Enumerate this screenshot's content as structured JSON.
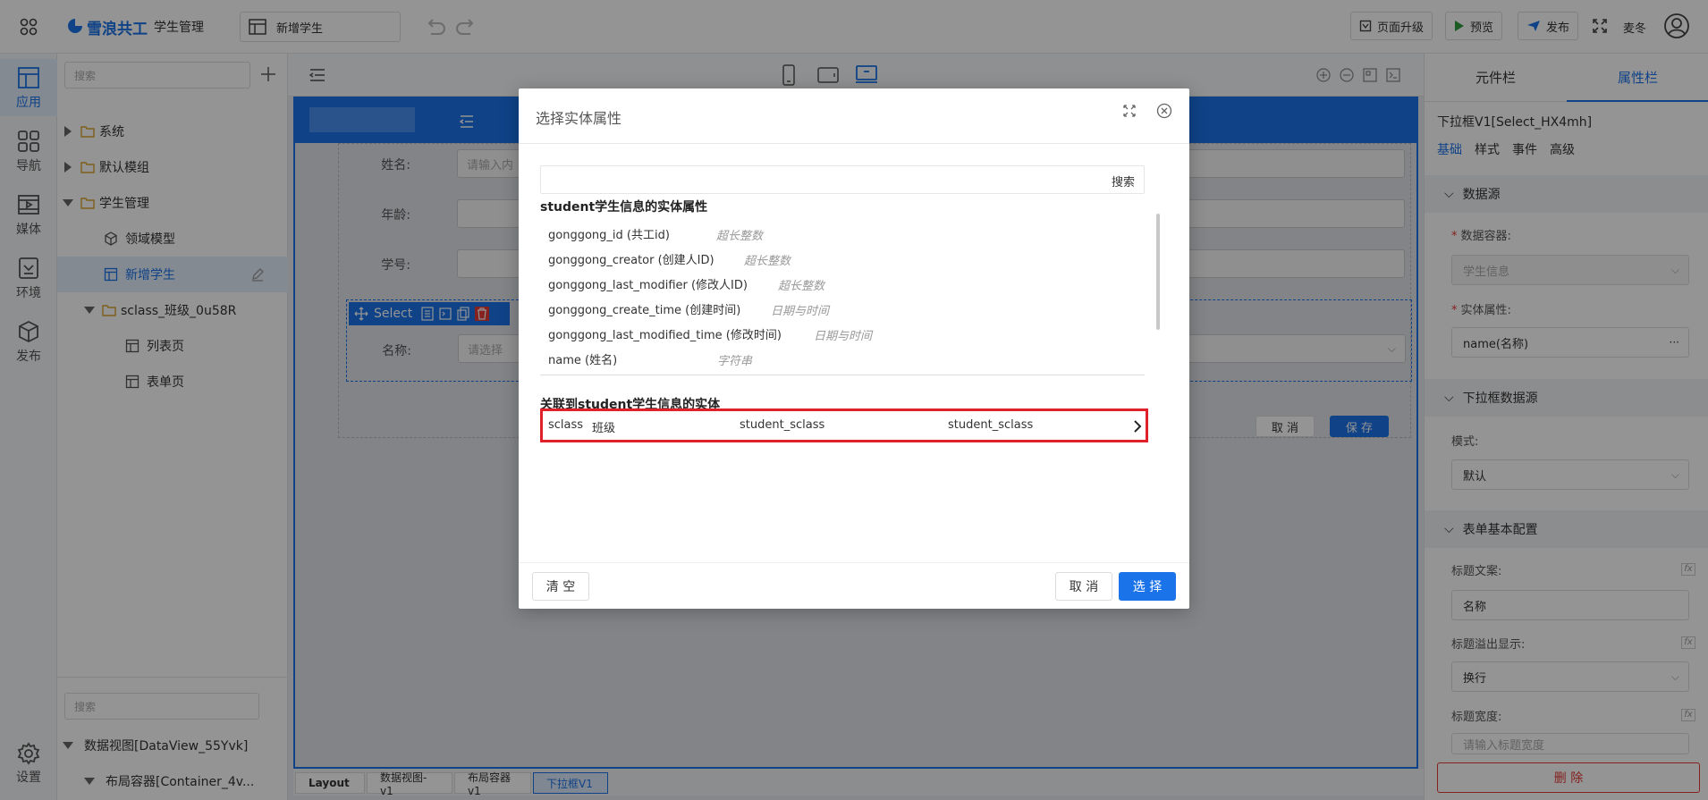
{
  "topbar": {
    "brand": "雪浪共工",
    "app_name": "学生管理",
    "page_selector": "新增学生",
    "upgrade_label": "页面升级",
    "preview_label": "预览",
    "publish_label": "发布",
    "user_name": "麦冬"
  },
  "rail": {
    "items": [
      {
        "label": "应用",
        "icon": "layout-icon"
      },
      {
        "label": "导航",
        "icon": "grid-icon"
      },
      {
        "label": "媒体",
        "icon": "media-icon"
      },
      {
        "label": "环境",
        "icon": "env-icon"
      },
      {
        "label": "发布",
        "icon": "cube-icon"
      }
    ],
    "settings_label": "设置"
  },
  "tree": {
    "search_placeholder": "搜索",
    "items": [
      {
        "label": "系统"
      },
      {
        "label": "默认模组"
      },
      {
        "label": "学生管理"
      },
      {
        "label": "领域模型"
      },
      {
        "label": "新增学生"
      },
      {
        "label": "sclass_班级_0u58R"
      },
      {
        "label": "列表页"
      },
      {
        "label": "表单页"
      }
    ],
    "bottom_search_placeholder": "搜索",
    "outline": [
      {
        "label": "数据视图[DataView_55Yvk]"
      },
      {
        "label": "布局容器[Container_4v..."
      }
    ]
  },
  "canvas": {
    "form": {
      "name_label": "姓名:",
      "name_placeholder": "请输入内",
      "age_label": "年龄:",
      "id_label": "学号:",
      "select_label": "名称:",
      "select_placeholder": "请选择",
      "select_toolbar_label": "Select",
      "cancel_label": "取 消",
      "save_label": "保 存"
    },
    "breadcrumb": [
      "Layout",
      "数据视图-v1",
      "布局容器v1",
      "下拉框V1"
    ]
  },
  "rightpanel": {
    "tabs": [
      "元件栏",
      "属性栏"
    ],
    "active_tab": 1,
    "component_title": "下拉框V1[Select_HX4mh]",
    "subtabs": [
      "基础",
      "样式",
      "事件",
      "高级"
    ],
    "sections": {
      "datasource": {
        "title": "数据源",
        "container_label": "数据容器:",
        "container_value": "学生信息",
        "entity_attr_label": "实体属性:",
        "entity_attr_value": "name(名称)",
        "entity_attr_more": "···"
      },
      "select_ds": {
        "title": "下拉框数据源",
        "mode_label": "模式:",
        "mode_value": "默认"
      },
      "form_basic": {
        "title": "表单基本配置",
        "title_text_label": "标题文案:",
        "title_text_value": "名称",
        "overflow_label": "标题溢出显示:",
        "overflow_value": "换行",
        "width_label": "标题宽度:",
        "width_placeholder": "请输入标题宽度"
      }
    },
    "delete_label": "删 除"
  },
  "modal": {
    "title": "选择实体属性",
    "search_button": "搜索",
    "entity_section_title": "student学生信息的实体属性",
    "attributes": [
      {
        "name": "gonggong_id (共工id)",
        "type": "超长整数"
      },
      {
        "name": "gonggong_creator (创建人ID)",
        "type": "超长整数"
      },
      {
        "name": "gonggong_last_modifier (修改人ID)",
        "type": "超长整数"
      },
      {
        "name": "gonggong_create_time (创建时间)",
        "type": "日期与时间"
      },
      {
        "name": "gonggong_last_modified_time (修改时间)",
        "type": "日期与时间"
      },
      {
        "name": "name (姓名)",
        "type": "字符串"
      }
    ],
    "related_section_title": "关联到student学生信息的实体",
    "related": {
      "name": "sclass",
      "label": "班级",
      "col2": "student_sclass",
      "col3": "student_sclass"
    },
    "clear_label": "清 空",
    "cancel_label": "取 消",
    "select_label": "选 择",
    "highlight_color": "#e0202a"
  },
  "colors": {
    "accent": "#1a73e8",
    "danger": "#e53935",
    "preview_green": "#2e9b3e"
  }
}
